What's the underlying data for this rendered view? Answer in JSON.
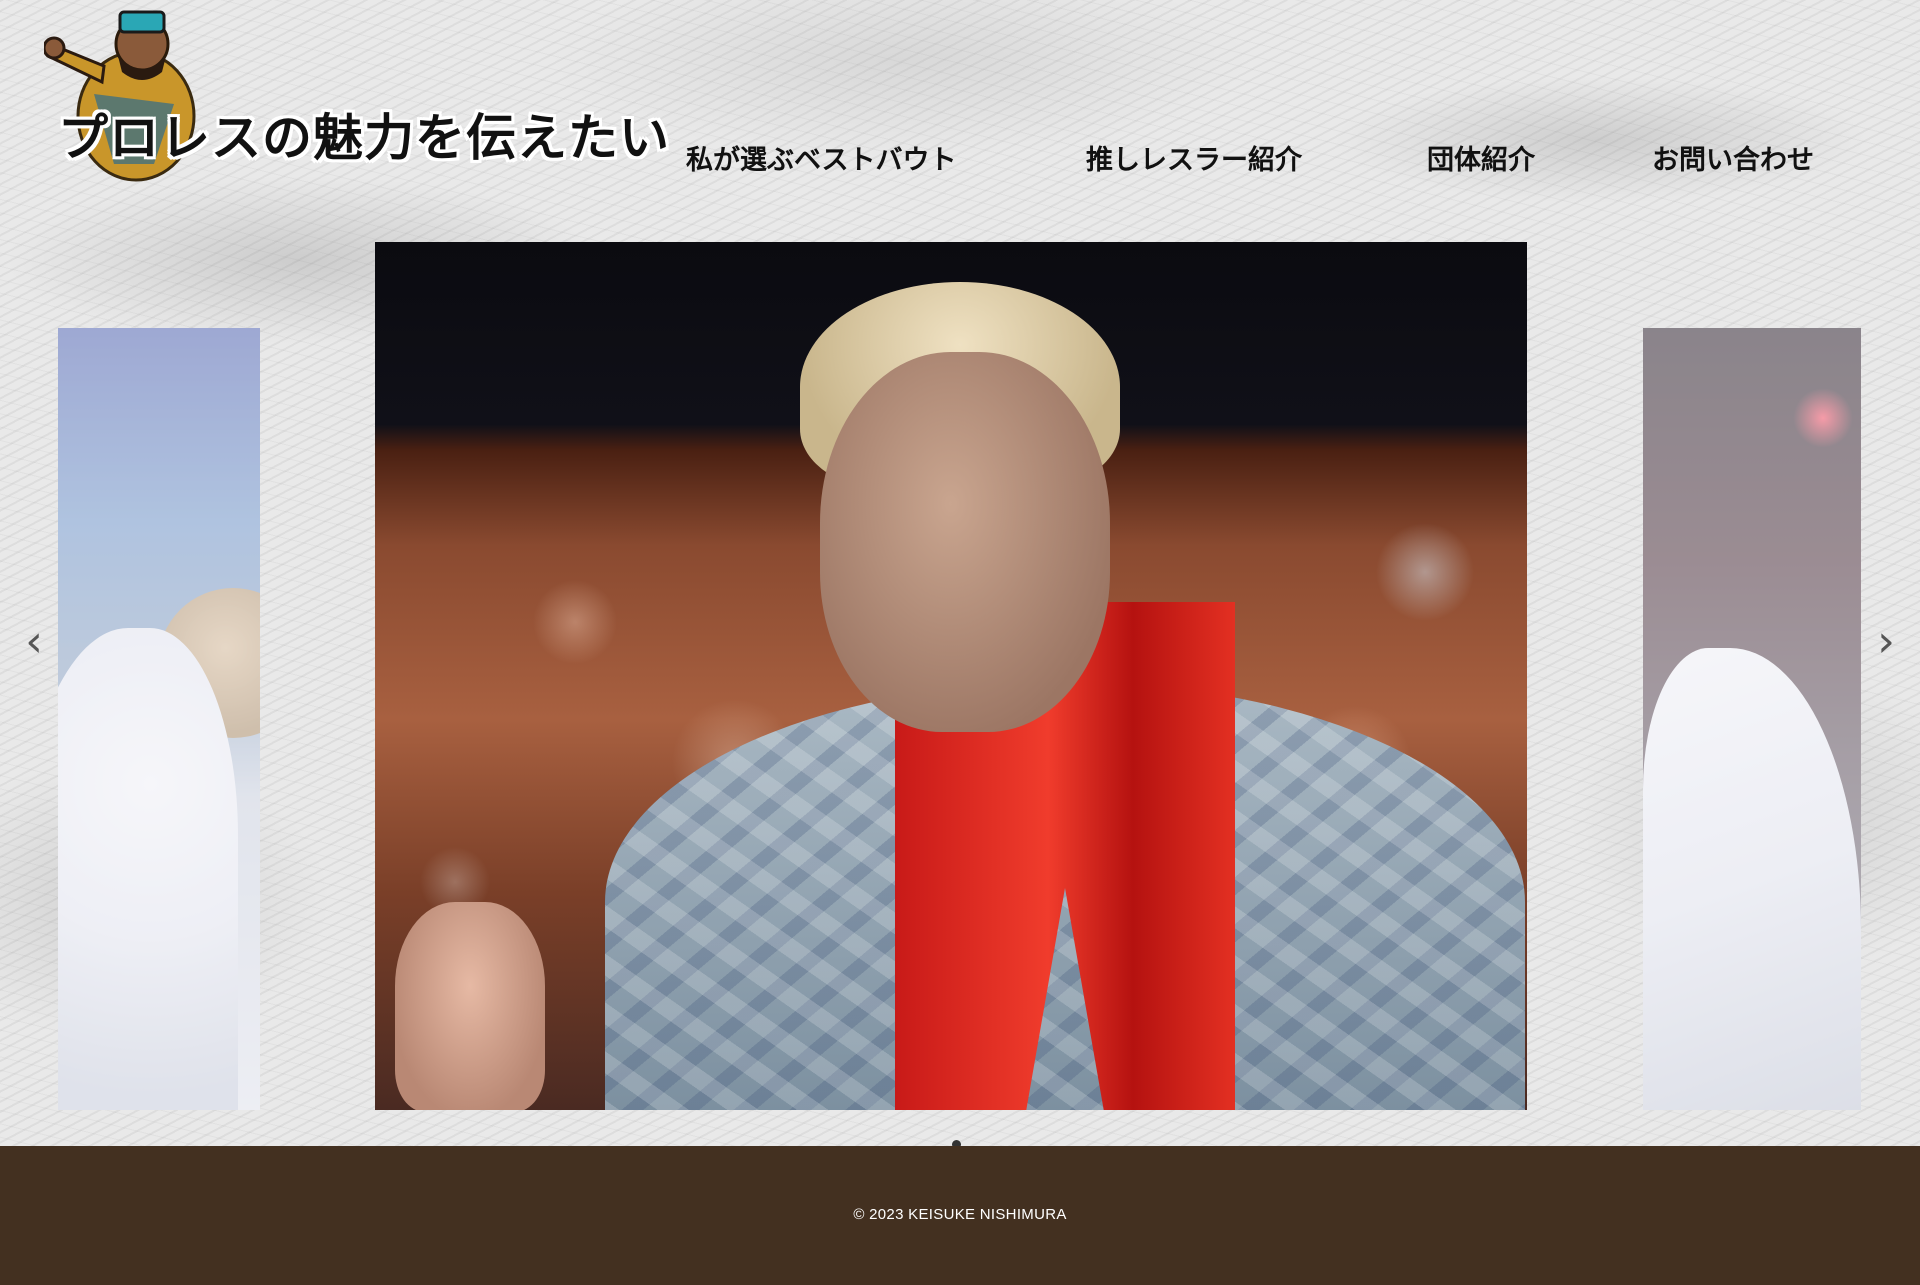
{
  "header": {
    "logo_text": "プロレスの魅力を伝えたい"
  },
  "nav": {
    "items": [
      {
        "label": "私が選ぶベストバウト"
      },
      {
        "label": "推しレスラー紹介"
      },
      {
        "label": "団体紹介"
      },
      {
        "label": "お問い合わせ"
      }
    ]
  },
  "slider": {
    "prev_icon": "chevron-left-icon",
    "next_icon": "chevron-right-icon",
    "prev_glyph": "‹",
    "next_glyph": "›",
    "active_index": 1
  },
  "footer": {
    "copyright": "© 2023 KEISUKE NISHIMURA"
  },
  "colors": {
    "footer_bg": "#433020",
    "nav_text": "#111111"
  }
}
